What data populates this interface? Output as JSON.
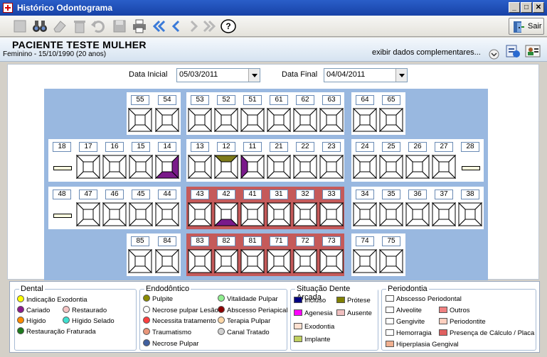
{
  "window": {
    "title": "Histórico Odontograma"
  },
  "toolbar": {
    "sair_label": "Sair"
  },
  "patient": {
    "name": "PACIENTE TESTE MULHER",
    "info": "Feminino - 15/10/1990 (20 anos)",
    "extra_link": "exibir dados complementares..."
  },
  "filters": {
    "start_label": "Data Inicial",
    "start_value": "05/03/2011",
    "end_label": "Data Final",
    "end_value": "04/04/2011"
  },
  "teeth": {
    "row1": [
      "55",
      "54",
      "53",
      "52",
      "51",
      "61",
      "62",
      "63",
      "64",
      "65"
    ],
    "row2": [
      "18",
      "17",
      "16",
      "15",
      "14",
      "13",
      "12",
      "11",
      "21",
      "22",
      "23",
      "24",
      "25",
      "26",
      "27",
      "28"
    ],
    "row3": [
      "48",
      "47",
      "46",
      "45",
      "44",
      "43",
      "42",
      "41",
      "31",
      "32",
      "33",
      "34",
      "35",
      "36",
      "37",
      "38"
    ],
    "row4": [
      "85",
      "84",
      "83",
      "82",
      "81",
      "71",
      "72",
      "73",
      "74",
      "75"
    ]
  },
  "legend": {
    "dental": {
      "title": "Dental",
      "items": [
        {
          "label": "Indicação Exodontia",
          "color": "#ffff00"
        },
        {
          "label": "Cariado",
          "color": "#8b1a8b"
        },
        {
          "label": "Restaurado",
          "color": "#f4c2c2"
        },
        {
          "label": "Hígido",
          "color": "#ff8c00"
        },
        {
          "label": "Hígido Selado",
          "color": "#40e0d0"
        },
        {
          "label": "Restauração Fraturada",
          "color": "#1e7b1e"
        }
      ]
    },
    "endo": {
      "title": "Endodôntico",
      "items": [
        {
          "label": "Pulpite",
          "color": "#8b8b00"
        },
        {
          "label": "Vitalidade Pulpar",
          "color": "#90ee90"
        },
        {
          "label": "Necrose pulpar Lesão",
          "color": "#ffffff"
        },
        {
          "label": "Abscesso Periapical",
          "color": "#8b0000"
        },
        {
          "label": "Necessita tratamento",
          "color": "#ff4040"
        },
        {
          "label": "Terapia Pulpar",
          "color": "#ffd8a8"
        },
        {
          "label": "Traumatismo",
          "color": "#e9967a"
        },
        {
          "label": "Canal Tratado",
          "color": "#d0d0d0"
        },
        {
          "label": "Necrose Pulpar",
          "color": "#4060a0"
        }
      ]
    },
    "arcada": {
      "title": "Situação Dente Arcada",
      "items": [
        {
          "label": "Incluso",
          "color": "#000080"
        },
        {
          "label": "Prótese",
          "color": "#808000"
        },
        {
          "label": "Agenesia",
          "color": "#ff00ff"
        },
        {
          "label": "Ausente",
          "color": "#f0c0c0"
        },
        {
          "label": "Exodontia",
          "color": "#ffe0d0"
        },
        {
          "label": "Implante",
          "color": "#c0d060"
        }
      ]
    },
    "perio": {
      "title": "Periodontia",
      "items": [
        {
          "label": "Abscesso Periodontal",
          "color": "#ffffff"
        },
        {
          "label": "Alveolite",
          "color": "#ffffff"
        },
        {
          "label": "Outros",
          "color": "#f08080"
        },
        {
          "label": "Gengivite",
          "color": "#ffffff"
        },
        {
          "label": "Periodontite",
          "color": "#ffd0c0"
        },
        {
          "label": "Hemorragia",
          "color": "#ffffff"
        },
        {
          "label": "Presença de Cálculo / Placa",
          "color": "#e06060"
        },
        {
          "label": "Hiperplasia Gengival",
          "color": "#f0b090"
        }
      ]
    }
  }
}
